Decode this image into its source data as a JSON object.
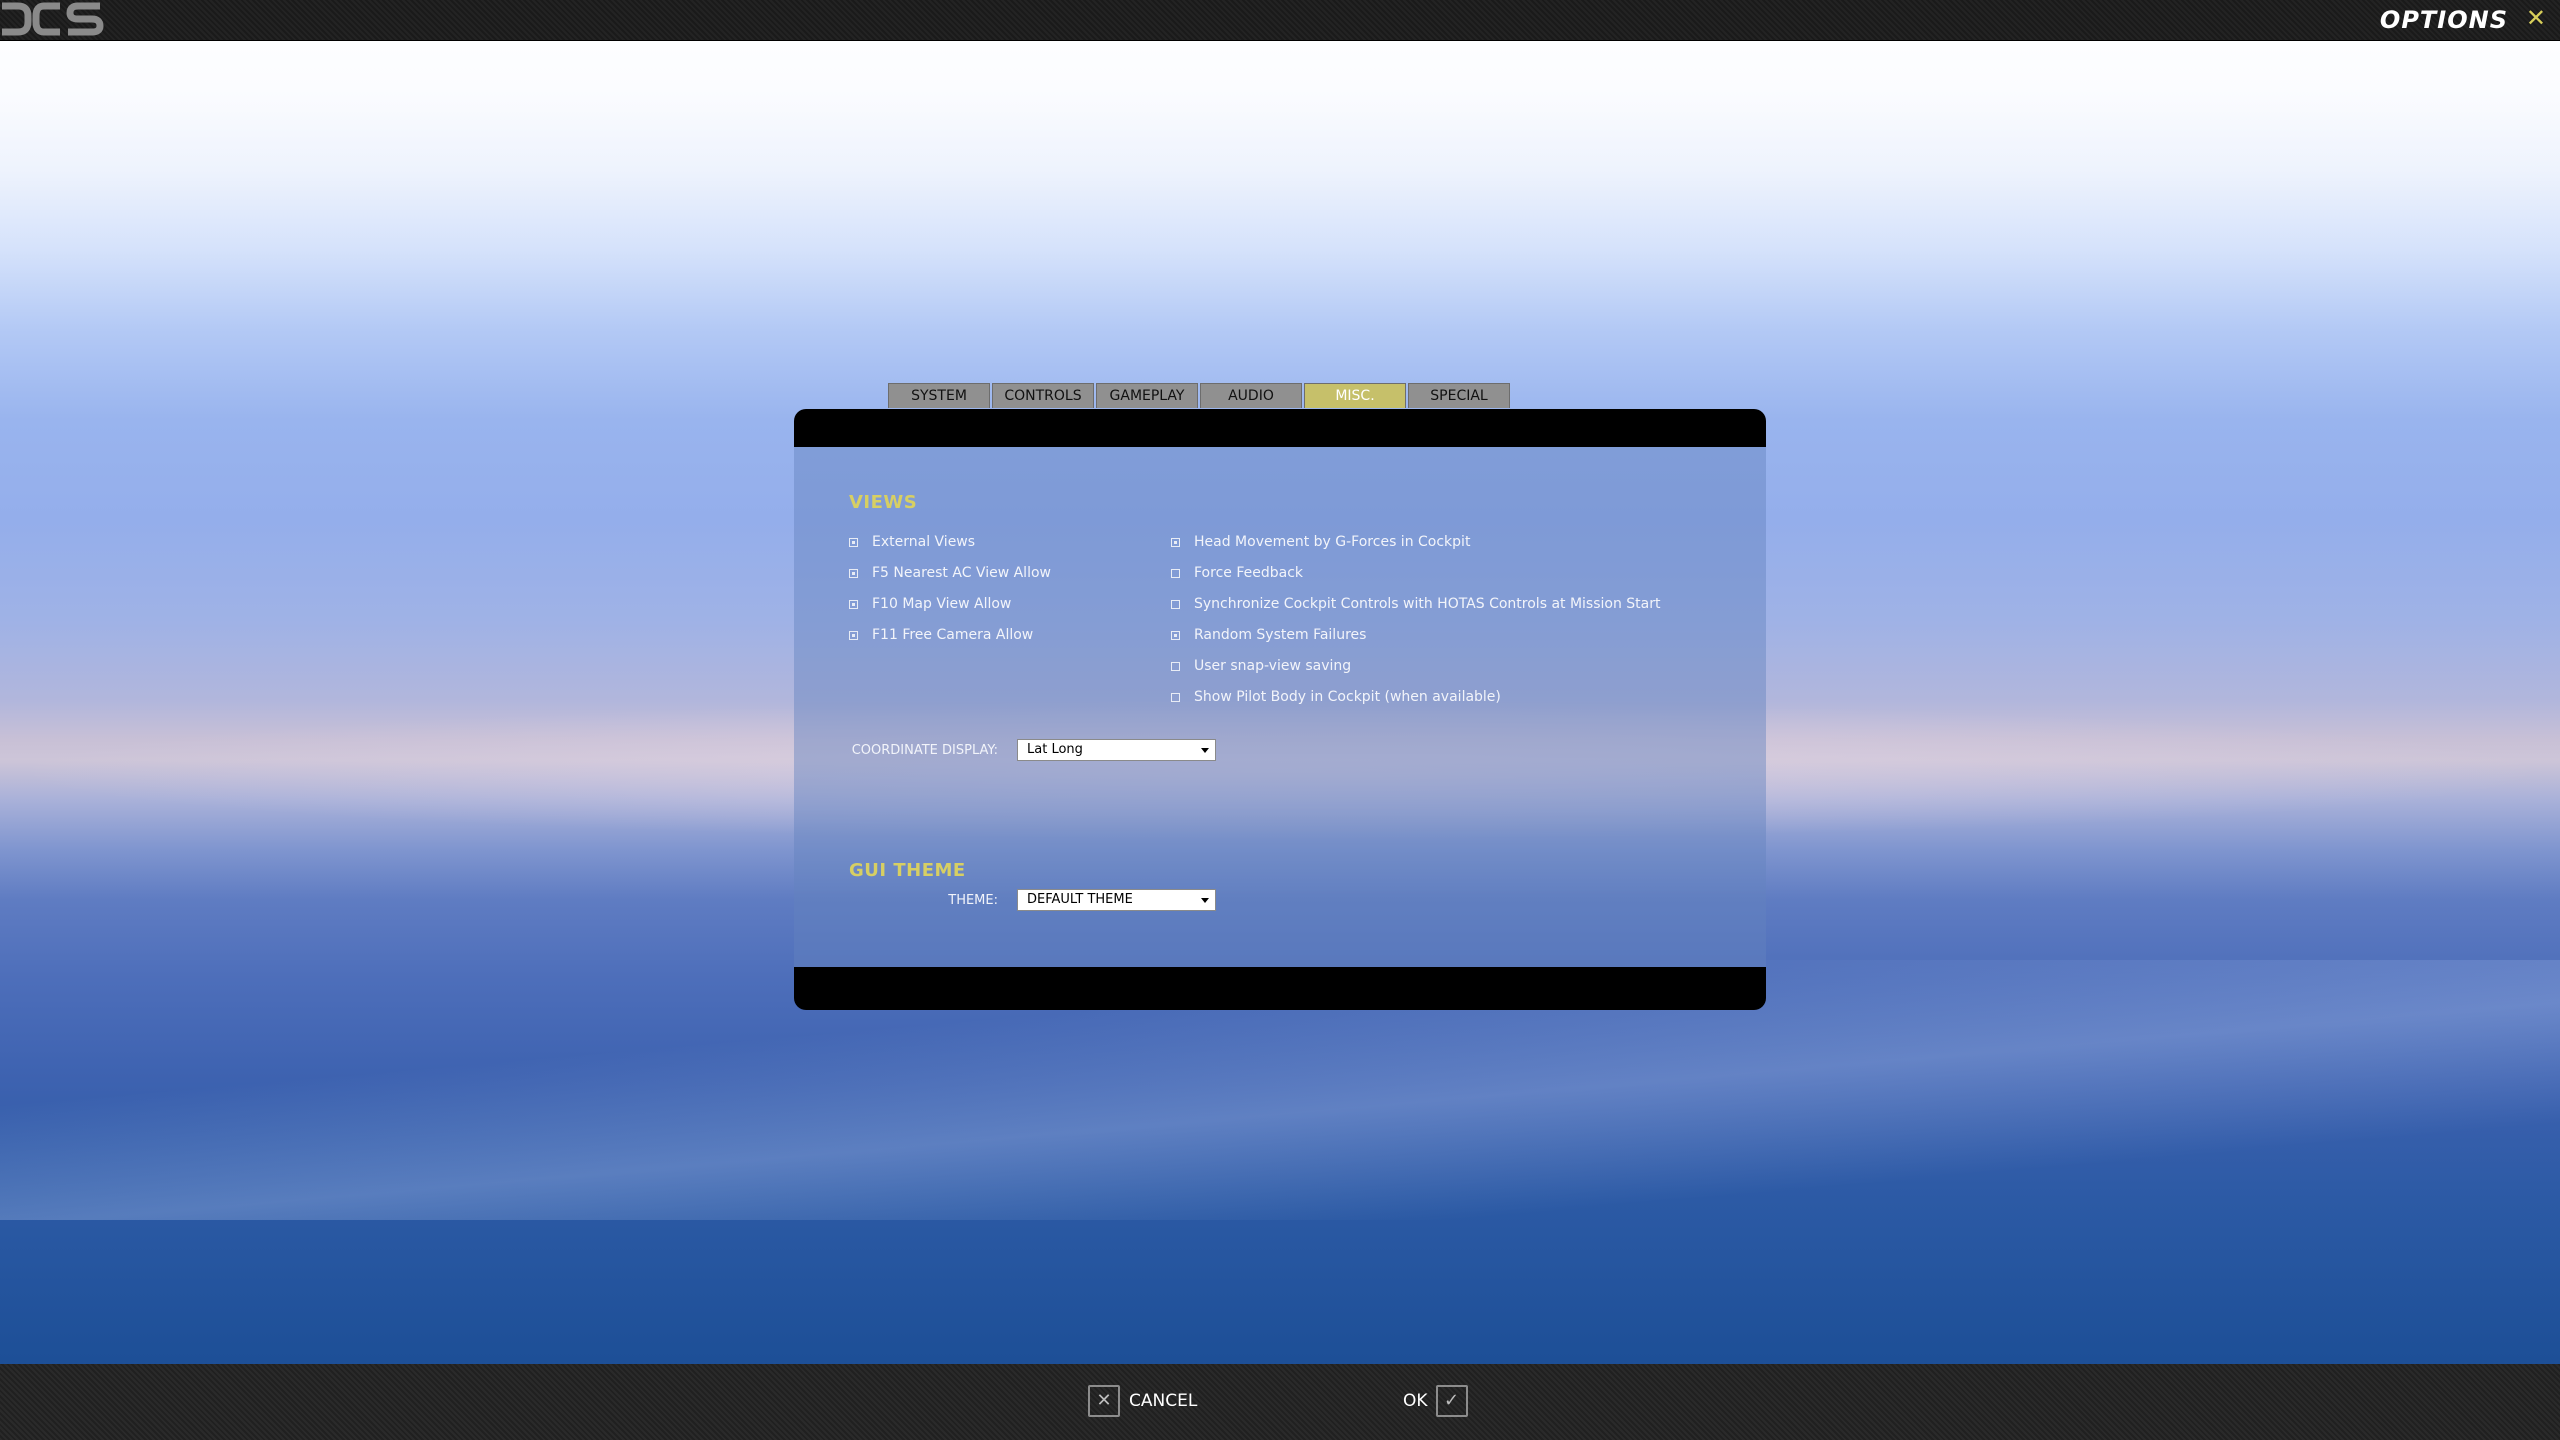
{
  "app": {
    "title": "OPTIONS",
    "logo_icon": "dcs-logo-icon",
    "close_icon": "close-icon"
  },
  "tabs": [
    {
      "label": "SYSTEM",
      "active": false
    },
    {
      "label": "CONTROLS",
      "active": false
    },
    {
      "label": "GAMEPLAY",
      "active": false
    },
    {
      "label": "AUDIO",
      "active": false
    },
    {
      "label": "MISC.",
      "active": true
    },
    {
      "label": "SPECIAL",
      "active": false
    }
  ],
  "views": {
    "title": "VIEWS",
    "left": [
      {
        "label": "External Views",
        "checked": true
      },
      {
        "label": "F5 Nearest AC View Allow",
        "checked": true
      },
      {
        "label": "F10 Map View Allow",
        "checked": true
      },
      {
        "label": "F11 Free Camera Allow",
        "checked": true
      }
    ],
    "right": [
      {
        "label": "Head Movement by G-Forces in Cockpit",
        "checked": true
      },
      {
        "label": "Force Feedback",
        "checked": false
      },
      {
        "label": "Synchronize Cockpit Controls with HOTAS Controls at Mission Start",
        "checked": false
      },
      {
        "label": "Random System Failures",
        "checked": true
      },
      {
        "label": "User snap-view saving",
        "checked": false
      },
      {
        "label": "Show Pilot Body in Cockpit (when available)",
        "checked": false
      }
    ],
    "coordinate_label": "COORDINATE DISPLAY:",
    "coordinate_value": "Lat Long"
  },
  "gui_theme": {
    "title": "GUI THEME",
    "theme_label": "THEME:",
    "theme_value": "DEFAULT THEME"
  },
  "footer": {
    "cancel_label": "CANCEL",
    "ok_label": "OK",
    "cancel_icon": "x-icon",
    "ok_icon": "check-icon"
  },
  "colors": {
    "accent": "#d7cf63",
    "active_tab": "#c6c06a",
    "tab": "#909090",
    "bar": "#202020"
  }
}
